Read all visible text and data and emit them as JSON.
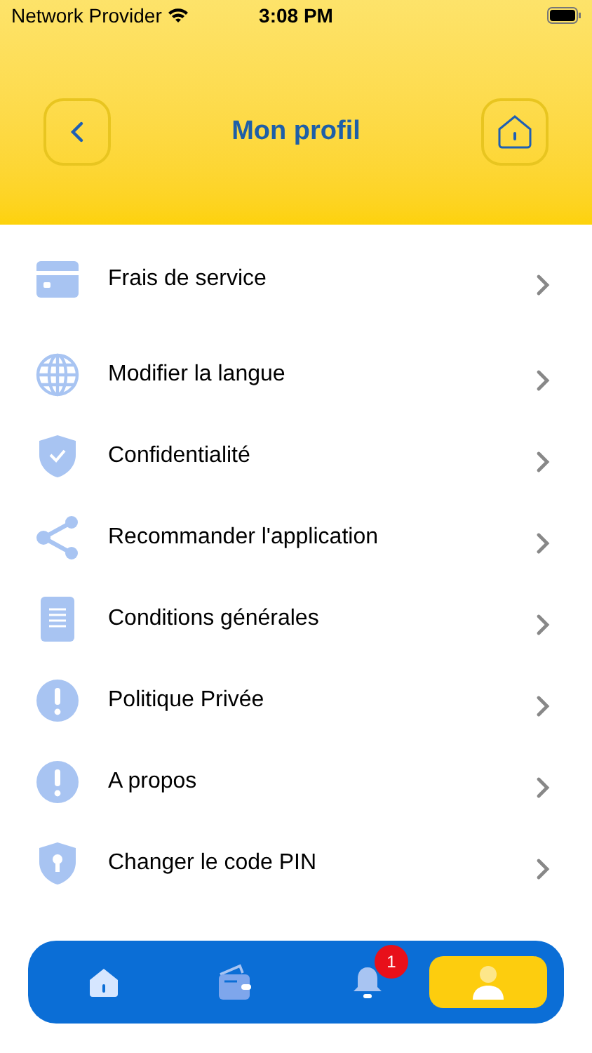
{
  "status_bar": {
    "carrier": "Network Provider",
    "time": "3:08 PM"
  },
  "header": {
    "title": "Mon profil"
  },
  "menu": [
    {
      "label": "Frais de service",
      "kind": "card"
    },
    {
      "label": "Modifier la langue",
      "kind": "globe"
    },
    {
      "label": "Confidentialité",
      "kind": "shield"
    },
    {
      "label": "Recommander l'application",
      "kind": "share"
    },
    {
      "label": "Conditions générales",
      "kind": "document"
    },
    {
      "label": "Politique Privée",
      "kind": "info"
    },
    {
      "label": "A propos",
      "kind": "info"
    },
    {
      "label": "Changer le code PIN",
      "kind": "lock"
    }
  ],
  "tab_bar": [
    {
      "kind": "home",
      "selected": false
    },
    {
      "kind": "wallet",
      "selected": false
    },
    {
      "kind": "bell",
      "selected": false,
      "badge": "1"
    },
    {
      "kind": "profile",
      "selected": true
    }
  ]
}
